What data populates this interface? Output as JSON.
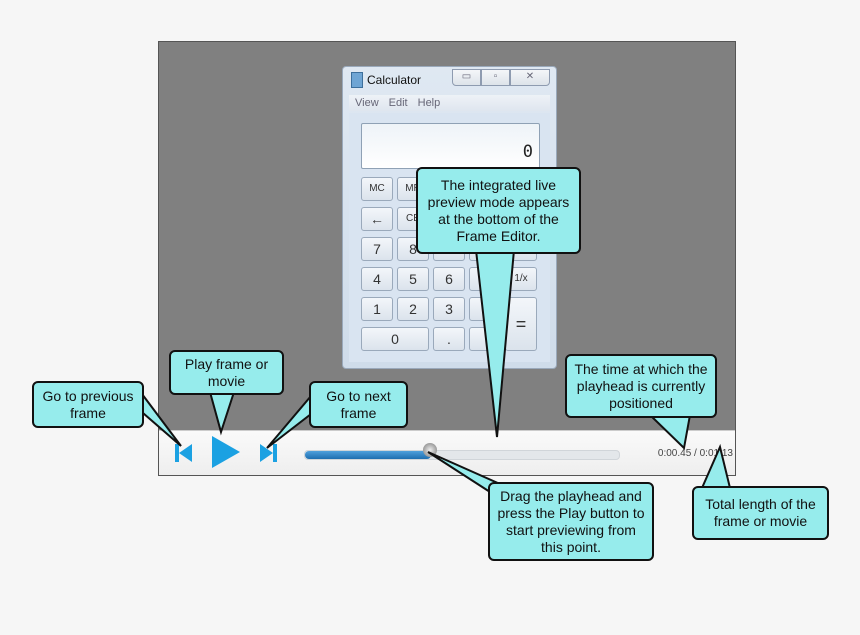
{
  "calculator": {
    "title": "Calculator",
    "menu": [
      "View",
      "Edit",
      "Help"
    ],
    "display": "0",
    "keys": {
      "mc": "MC",
      "mr": "MR",
      "back": "←",
      "ce": "CE",
      "k7": "7",
      "k8": "8",
      "k4": "4",
      "k5": "5",
      "k6": "6",
      "recip": "1/x",
      "k1": "1",
      "k2": "2",
      "k3": "3",
      "eq": "=",
      "k0": "0",
      "dot": "."
    }
  },
  "player": {
    "progress_percent": 40,
    "current_time": "0:00.45",
    "total_time": "0:01.13",
    "time_separator": " / ",
    "accent": "#1ba1e2"
  },
  "callouts": {
    "prev": "Go to previous frame",
    "play": "Play frame or movie",
    "next": "Go to next frame",
    "preview": "The integrated live preview mode appears at the bottom of the Frame Editor.",
    "time": "The time at which the playhead is currently positioned",
    "drag": "Drag the playhead and press the Play button to start previewing from this point.",
    "total": "Total length of the frame or movie"
  },
  "callout_color": "#96ecec"
}
